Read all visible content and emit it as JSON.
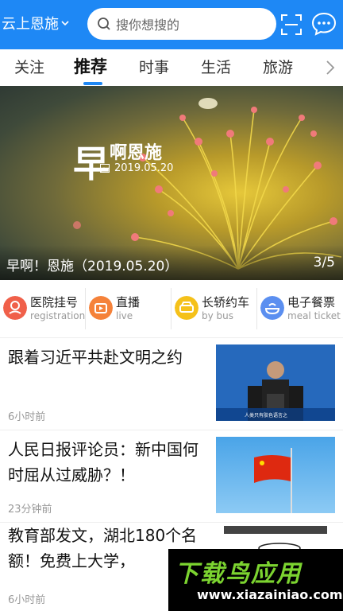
{
  "header": {
    "city": "云上恩施",
    "search_placeholder": "搜你想搜的",
    "accent_color": "#1e88f5"
  },
  "tabs": [
    {
      "label": "关注",
      "active": false
    },
    {
      "label": "推荐",
      "active": true
    },
    {
      "label": "时事",
      "active": false
    },
    {
      "label": "生活",
      "active": false
    },
    {
      "label": "旅游",
      "active": false
    }
  ],
  "banner": {
    "logo_big": "早",
    "logo_rest": "啊恩施",
    "logo_date": "2019.05.20",
    "caption": "早啊！恩施（2019.05.20）",
    "counter": "3/5"
  },
  "services": [
    {
      "title": "医院挂号",
      "sub": "registration",
      "icon": "hospital-icon",
      "color": "#f0604a"
    },
    {
      "title": "直播",
      "sub": "live",
      "icon": "live-tv-icon",
      "color": "#f5823a"
    },
    {
      "title": "长轿约车",
      "sub": "by bus",
      "icon": "car-icon",
      "color": "#f5c11a"
    },
    {
      "title": "电子餐票",
      "sub": "meal ticket",
      "icon": "meal-icon",
      "color": "#5b8ff0"
    }
  ],
  "news": [
    {
      "headline": "跟着习近平共赴文明之约",
      "time": "6小时前",
      "thumb": "conference-photo"
    },
    {
      "headline": "人民日报评论员：新中国何时屈从过威胁？！",
      "time": "23分钟前",
      "thumb": "flag-photo"
    },
    {
      "headline": "教育部发文，湖北180个名额！免费上大学，",
      "time": "6小时前",
      "thumb": "poster-photo"
    }
  ],
  "thumb_texts": {
    "conference_caption": "人类只有肤色语言之"
  },
  "watermark": {
    "big": "下载鸟应用",
    "small": "www.xiazainiao.com"
  }
}
